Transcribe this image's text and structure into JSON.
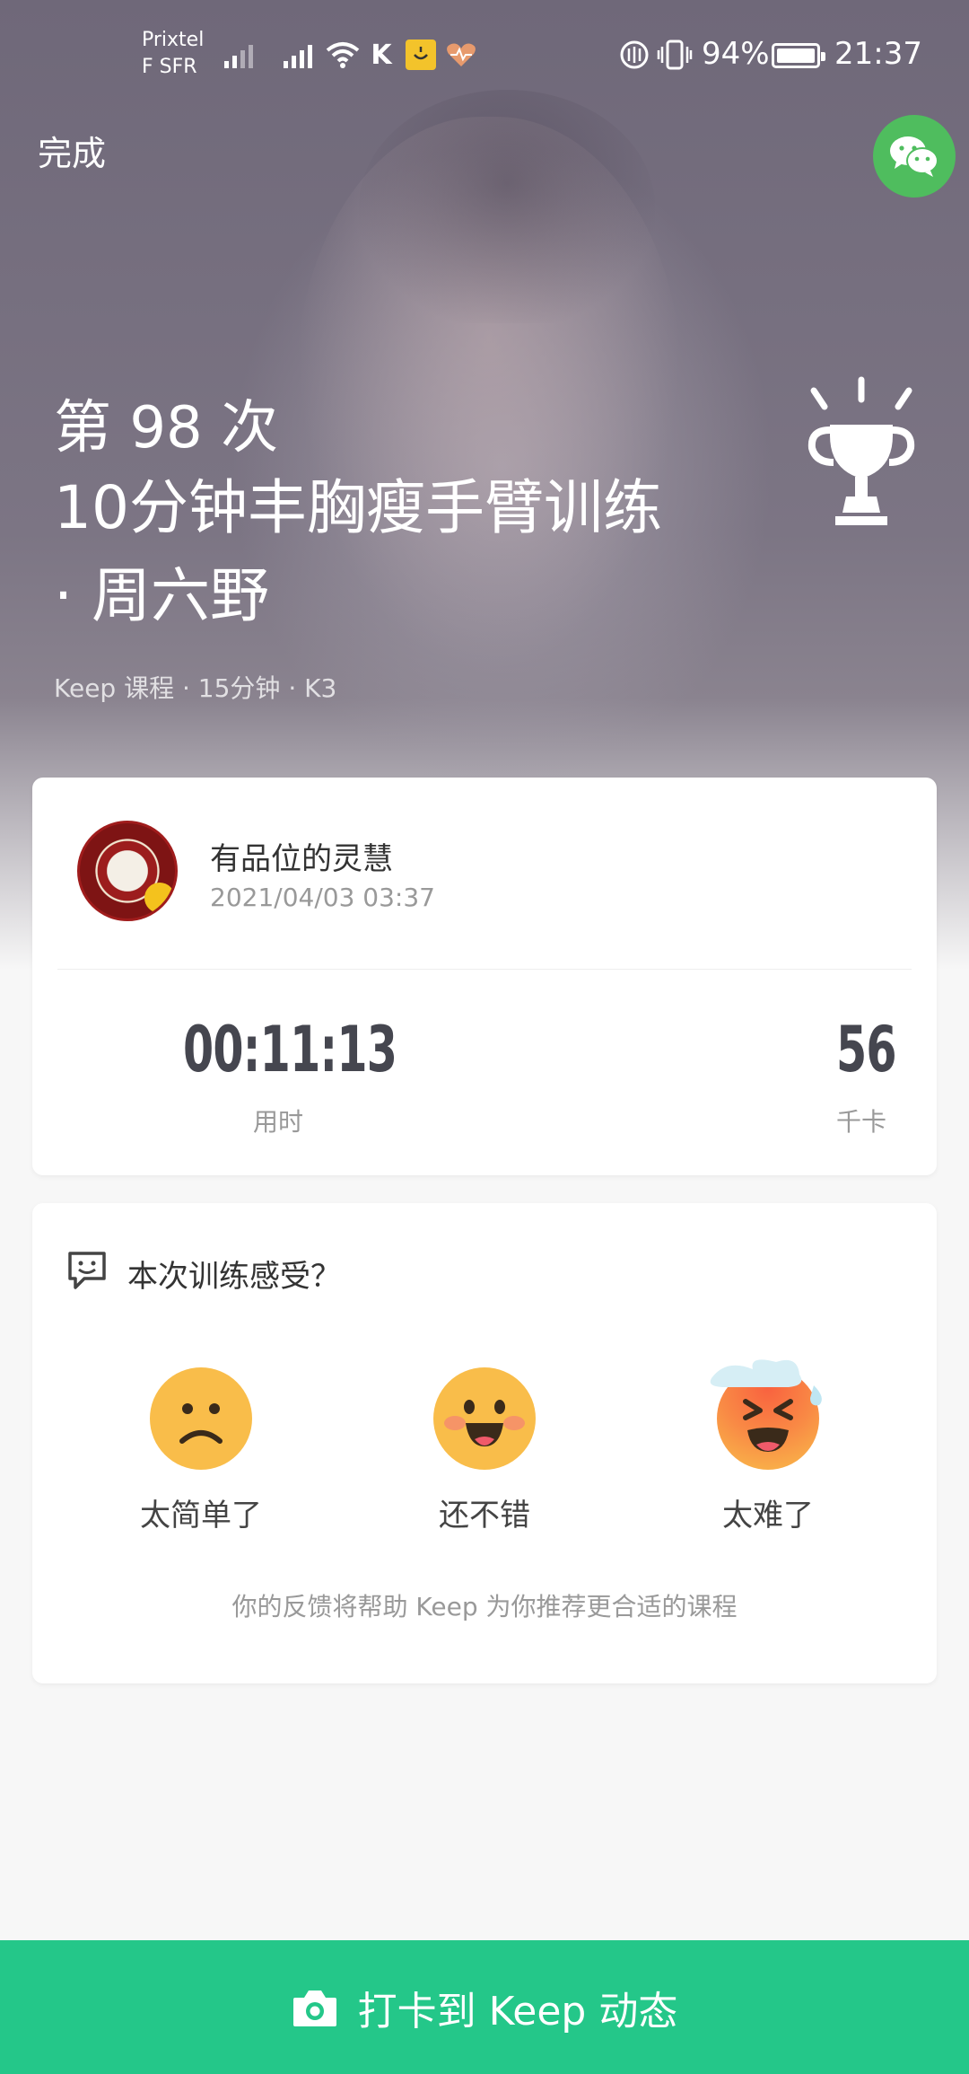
{
  "status_bar": {
    "carrier_line1": "Prixtel",
    "carrier_line2": "F SFR",
    "k_glyph": "K",
    "battery": "94%",
    "time": "21:37",
    "icons": [
      "signal-icon",
      "signal-roaming-icon",
      "wifi-icon",
      "k-app-icon",
      "smile-app-icon",
      "health-icon",
      "nfc-icon",
      "vibrate-icon",
      "battery-icon"
    ]
  },
  "header": {
    "done_label": "完成",
    "share_icon": "wechat-icon"
  },
  "workout": {
    "count_label": "第 98 次",
    "title": "10分钟丰胸瘦手臂训练 · 周六野",
    "meta": "Keep 课程 · 15分钟 · K3",
    "trophy_icon": "trophy-icon"
  },
  "record": {
    "username": "有品位的灵慧",
    "datetime": "2021/04/03 03:37",
    "duration_value": "00:11:13",
    "duration_label": "用时",
    "calories_value": "56",
    "calories_label": "千卡"
  },
  "feedback": {
    "title": "本次训练感受？",
    "options": [
      {
        "label": "太简单了",
        "icon": "sad-face-icon"
      },
      {
        "label": "还不错",
        "icon": "happy-face-icon"
      },
      {
        "label": "太难了",
        "icon": "sweat-face-icon"
      }
    ],
    "hint": "你的反馈将帮助 Keep 为你推荐更合适的课程"
  },
  "bottom_bar": {
    "label": "打卡到 Keep 动态",
    "icon": "camera-icon",
    "color": "#24c789"
  }
}
